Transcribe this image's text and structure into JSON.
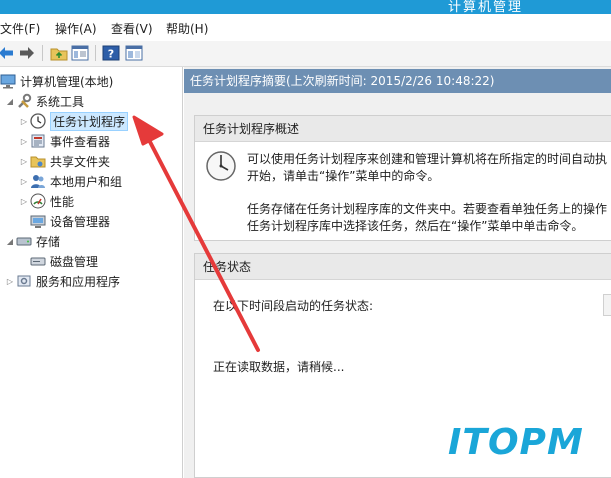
{
  "window": {
    "title": "计算机管理"
  },
  "menu": {
    "file": "文件(F)",
    "action": "操作(A)",
    "view": "查看(V)",
    "help": "帮助(H)"
  },
  "tree": {
    "root": "计算机管理(本地)",
    "system_tools": "系统工具",
    "task_scheduler": "任务计划程序",
    "event_viewer": "事件查看器",
    "shared_folders": "共享文件夹",
    "local_users": "本地用户和组",
    "performance": "性能",
    "device_manager": "设备管理器",
    "storage": "存储",
    "disk_management": "磁盘管理",
    "services_apps": "服务和应用程序"
  },
  "main": {
    "header": "任务计划程序摘要(上次刷新时间: 2015/2/26 10:48:22)",
    "overview": {
      "title": "任务计划程序概述",
      "line1": "可以使用任务计划程序来创建和管理计算机将在所指定的时间自动执",
      "line2": "开始，请单击“操作”菜单中的命令。",
      "line3": "任务存储在任务计划程序库的文件夹中。若要查看单独任务上的操作",
      "line4": "任务计划程序库中选择该任务，然后在“操作”菜单中单击命令。"
    },
    "status": {
      "title": "任务状态",
      "prompt": "在以下时间段启动的任务状态:",
      "loading": "正在读取数据，请稍候..."
    }
  },
  "watermark": "ITOPM",
  "colors": {
    "accent": "#1f9ad6",
    "header": "#6d8fb3",
    "arrow": "#e53a3a",
    "selection": "#cce8ff"
  }
}
